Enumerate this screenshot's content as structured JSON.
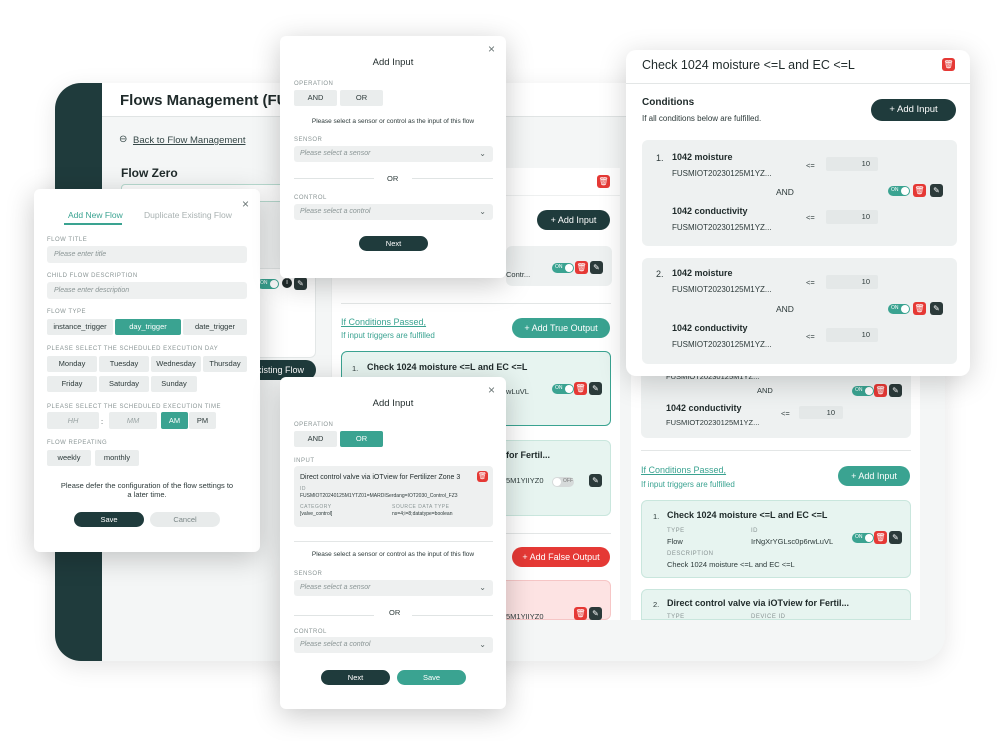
{
  "app": {
    "page_title": "Flows Management (FU",
    "back_link": "Back to Flow Management",
    "flow_name": "Flow Zero",
    "existing_flow_btn": "xisting Flow"
  },
  "middle": {
    "add_input": "+ Add Input",
    "contr_text": "Contr...",
    "if_passed": "If Conditions Passed,",
    "if_passed_sub": "If input triggers are fulfilled",
    "add_true_output": "+ Add True Output",
    "item1_num": "1.",
    "item1_title": "Check 1024 moisture <=L and EC <=L",
    "item1_sub": "wLuVL",
    "item2_title": "for Fertil...",
    "item2_sub": "5M1YIIYZ0",
    "add_false_output": "+ Add False Output",
    "item3_sub": "5M1YIIYZ0",
    "toggle_on": "ON",
    "toggle_off": "OFF"
  },
  "new_flow": {
    "tab_new": "Add New Flow",
    "tab_duplicate": "Duplicate Existing Flow",
    "flow_title_label": "FLOW TITLE",
    "flow_title_placeholder": "Please enter title",
    "child_desc_label": "CHILD FLOW DESCRIPTION",
    "child_desc_placeholder": "Please enter description",
    "flow_type_label": "FLOW TYPE",
    "flow_types": [
      "instance_trigger",
      "day_trigger",
      "date_trigger"
    ],
    "day_label": "PLEASE SELECT THE SCHEDULED EXECUTION DAY",
    "days_row1": [
      "Monday",
      "Tuesday",
      "Wednesday",
      "Thursday"
    ],
    "days_row2": [
      "Friday",
      "Saturday",
      "Sunday"
    ],
    "time_label": "PLEASE SELECT THE SCHEDULED EXECUTION TIME",
    "hh": "HH",
    "colon": ":",
    "mm": "MM",
    "am": "AM",
    "pm": "PM",
    "repeat_label": "FLOW REPEATING",
    "repeat": [
      "weekly",
      "monthly"
    ],
    "defer_text1": "Please defer the configuration of the flow settings to",
    "defer_text2": "a later time.",
    "save": "Save",
    "cancel": "Cancel"
  },
  "add_input_top": {
    "title": "Add Input",
    "operation_label": "OPERATION",
    "and": "AND",
    "or_btn": "OR",
    "instruction": "Please select a sensor or control as the input of this flow",
    "sensor_label": "SENSOR",
    "sensor_placeholder": "Please select a sensor",
    "or": "OR",
    "control_label": "CONTROL",
    "control_placeholder": "Please select a control",
    "next": "Next"
  },
  "add_input_bottom": {
    "title": "Add Input",
    "operation_label": "OPERATION",
    "and": "AND",
    "or_btn": "OR",
    "input_label": "INPUT",
    "input_title": "Direct control valve via iOTview for Fertilizer Zone 3",
    "id_label": "ID",
    "id_value": "FUSMIOT20240125M1YTZ01=MARDISerdang=IOT2030_Control_FZ3",
    "category_label": "CATEGORY",
    "category_value": "[valve_control]",
    "source_type_label": "SOURCE DATA TYPE",
    "source_type_value": "ns=4;i=8;datatype=boolean",
    "instruction": "Please select a sensor or control as the input of this flow",
    "sensor_label": "SENSOR",
    "sensor_placeholder": "Please select a sensor",
    "or": "OR",
    "control_label": "CONTROL",
    "control_placeholder": "Please select a control",
    "next": "Next",
    "save": "Save"
  },
  "right_panel": {
    "title": "Check 1024 moisture <=L and EC <=L",
    "conditions": "Conditions",
    "conditions_sub": "If all conditions below are fulfilled.",
    "add_input": "+ Add Input",
    "card1": {
      "num": "1.",
      "a_name": "1042 moisture",
      "a_id": "FUSMIOT20230125M1YZ...",
      "a_op": "<=",
      "a_val": "10",
      "join": "AND",
      "b_name": "1042 conductivity",
      "b_id": "FUSMIOT20230125M1YZ...",
      "b_op": "<=",
      "b_val": "10"
    },
    "card2": {
      "num": "2.",
      "a_name": "1042 moisture",
      "a_id": "FUSMIOT20230125M1YZ...",
      "a_op": "<=",
      "a_val": "10",
      "join": "AND",
      "b_name": "1042 conductivity",
      "b_id": "FUSMIOT20230125M1YZ...",
      "b_op": "<=",
      "b_val": "10"
    },
    "toggle_on": "ON"
  },
  "right_col": {
    "partial_id": "FUSMIOT20230125M1YZ...",
    "join": "AND",
    "cond_name": "1042 conductivity",
    "cond_id": "FUSMIOT20230125M1YZ...",
    "cond_op": "<=",
    "cond_val": "10",
    "if_passed": "If Conditions Passed,",
    "if_passed_sub": "If input triggers are fulfilled",
    "add_input": "+ Add Input",
    "item1_num": "1.",
    "item1_title": "Check 1024 moisture <=L and EC <=L",
    "type_label": "TYPE",
    "type_value": "Flow",
    "id_label": "ID",
    "id_value": "IrNgXrYGLsc0p6rwLuVL",
    "desc_label": "DESCRIPTION",
    "desc_value": "Check 1024 moisture <=L and EC <=L",
    "item2_num": "2.",
    "item2_title": "Direct control valve via iOTview  for Fertil...",
    "type_label2": "TYPE",
    "device_id_label": "DEVICE ID",
    "toggle_on": "ON"
  }
}
